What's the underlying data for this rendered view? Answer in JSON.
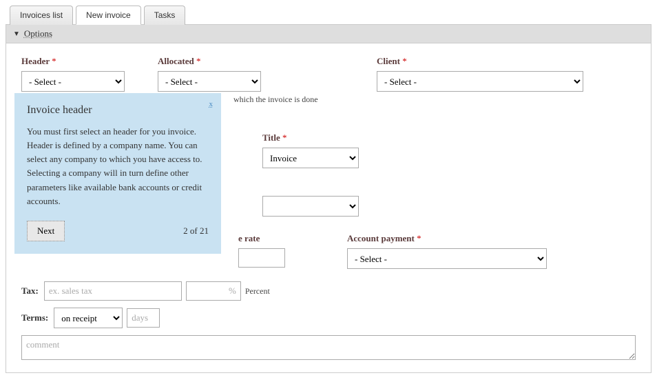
{
  "tabs": {
    "invoices": "Invoices list",
    "new": "New invoice",
    "tasks": "Tasks"
  },
  "section": {
    "title": "Options"
  },
  "labels": {
    "header": "Header",
    "allocated": "Allocated",
    "client": "Client",
    "title": "Title",
    "rate": "e rate",
    "account_payment": "Account payment",
    "tax": "Tax:",
    "terms": "Terms:",
    "percent": "Percent",
    "days_placeholder": "days",
    "tax_placeholder": "ex. sales tax",
    "comment_placeholder": "comment",
    "percent_symbol": "%"
  },
  "required": "*",
  "options": {
    "select_placeholder": "- Select -",
    "title_value": "Invoice",
    "terms_value": "on receipt"
  },
  "allocated_help": "which the invoice is done",
  "popover": {
    "title": "Invoice header",
    "body": "You must first select an header for you invoice. Header is defined by a company name. You can select any company to which you have access to. Selecting a company will in turn define other parameters like available bank accounts or credit accounts.",
    "next": "Next",
    "step": "2 of 21",
    "close": "x"
  }
}
